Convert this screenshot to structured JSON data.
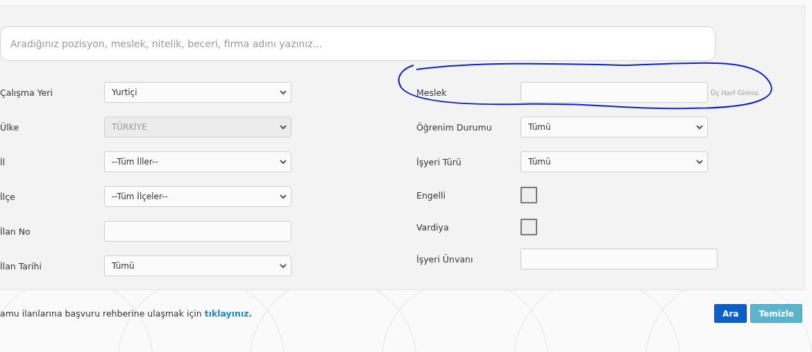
{
  "search": {
    "placeholder": "Aradığınız pozisyon, meslek, nitelik, beceri, firma adını yazınız..."
  },
  "left_fields": [
    {
      "kind": "select",
      "label": "Çalışma Yeri",
      "value": "Yurtiçi",
      "disabled": false
    },
    {
      "kind": "select",
      "label": "Ülke",
      "value": "TÜRKİYE",
      "disabled": true
    },
    {
      "kind": "select",
      "label": "İl",
      "value": "--Tüm İller--",
      "disabled": false
    },
    {
      "kind": "select",
      "label": "İlçe",
      "value": "--Tüm İlçeler--",
      "disabled": false
    },
    {
      "kind": "text",
      "label": "İlan No"
    },
    {
      "kind": "select",
      "label": "İlan Tarihi",
      "value": "Tümü",
      "disabled": false
    }
  ],
  "right_fields": [
    {
      "kind": "text",
      "label": "Meslek",
      "hint": "Üç Harf Giriniz.",
      "circled": true
    },
    {
      "kind": "select",
      "label": "Öğrenim Durumu",
      "value": "Tümü",
      "disabled": false
    },
    {
      "kind": "select",
      "label": "İşyeri Türü",
      "value": "Tümü",
      "disabled": false
    },
    {
      "kind": "checkbox",
      "label": "Engelli",
      "checked": false
    },
    {
      "kind": "checkbox",
      "label": "Vardiya",
      "checked": false
    },
    {
      "kind": "text",
      "label": "İşyeri Ünvanı",
      "wide": true
    }
  ],
  "footer": {
    "text": "amu ilanlarına başvuru rehberine ulaşmak için ",
    "link": "tıklayınız."
  },
  "buttons": [
    {
      "kind": "primary",
      "label": "Ara"
    },
    {
      "kind": "secondary",
      "label": "Temizle"
    }
  ]
}
